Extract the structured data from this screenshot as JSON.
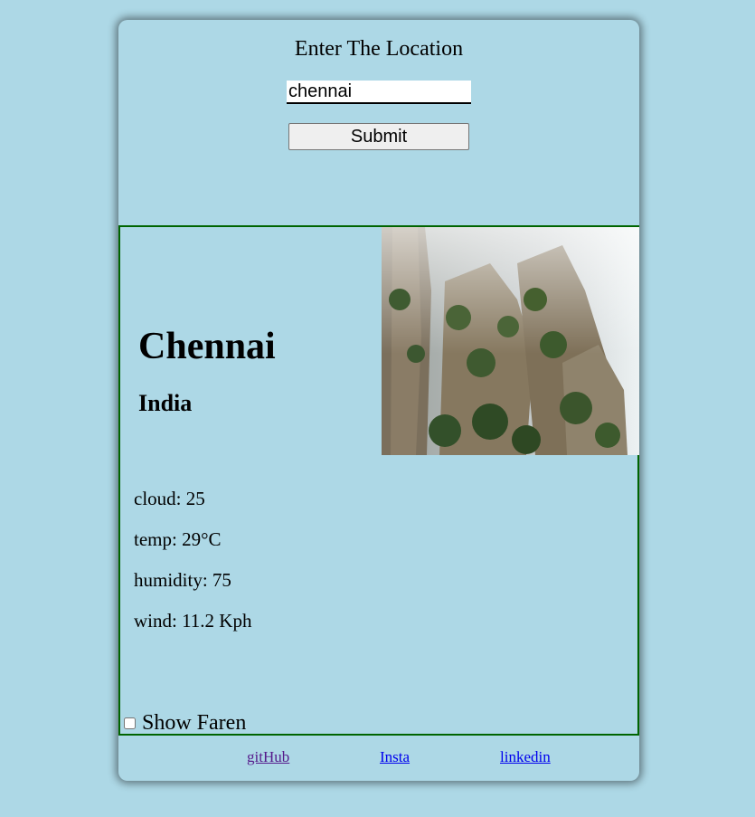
{
  "search": {
    "prompt": "Enter The Location",
    "input_value": "chennai",
    "submit_label": "Submit"
  },
  "weather": {
    "city": "Chennai",
    "country": "India",
    "cloud": "cloud: 25",
    "temp": "temp: 29°C",
    "humidity": "humidity: 75",
    "wind": "wind: 11.2 Kph",
    "toggle_label": "Show Faren",
    "toggle_checked": false,
    "image_subject": "misty-cliff-photo"
  },
  "footer": {
    "links": [
      {
        "label": "gitHub",
        "state": "visited"
      },
      {
        "label": "Insta",
        "state": "unvisited"
      },
      {
        "label": "linkedin",
        "state": "unvisited"
      }
    ]
  },
  "colors": {
    "background": "#add8e6",
    "card_border": "#006400",
    "link": "#0000ee",
    "visited_link": "#551a8b"
  }
}
